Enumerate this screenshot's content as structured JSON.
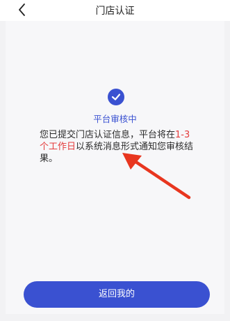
{
  "header": {
    "title": "门店认证",
    "back_icon": "chevron-left-icon"
  },
  "status": {
    "icon": "check-circle-icon",
    "title": "平台审核中",
    "description_prefix": "您已提交门店认证信息，平台将在",
    "description_highlight": "1-3个工作日",
    "description_suffix": "以系统消息形式通知您审核结果。"
  },
  "annotation": {
    "icon": "red-arrow-icon",
    "color": "#e8361f"
  },
  "actions": {
    "back_to_mine": "返回我的"
  },
  "colors": {
    "primary": "#3a51d1",
    "highlight": "#e43b3b"
  }
}
